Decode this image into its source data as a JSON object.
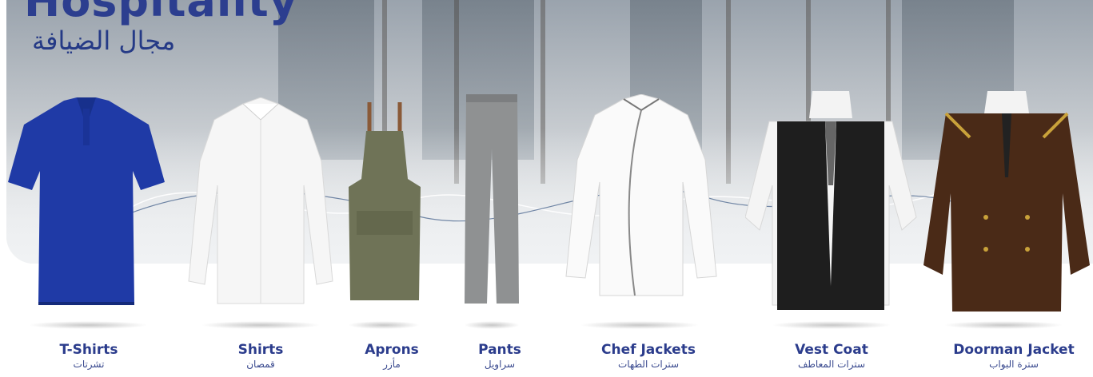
{
  "header": {
    "title_en": "Hospitality",
    "title_ar": "مجال الضيافة"
  },
  "products": [
    {
      "name_en": "T-Shirts",
      "name_ar": "تشرتات",
      "icon": "polo-tshirt-icon"
    },
    {
      "name_en": "Shirts",
      "name_ar": "قمصان",
      "icon": "dress-shirt-icon"
    },
    {
      "name_en": "Aprons",
      "name_ar": "مأزر",
      "icon": "apron-icon"
    },
    {
      "name_en": "Pants",
      "name_ar": "سراويل",
      "icon": "trousers-icon"
    },
    {
      "name_en": "Chef Jackets",
      "name_ar": "سترات الطهات",
      "icon": "chef-jacket-icon"
    },
    {
      "name_en": "Vest Coat",
      "name_ar": "سترات المعاطف",
      "icon": "vest-coat-icon"
    },
    {
      "name_en": "Doorman Jacket",
      "name_ar": "سترة البواب",
      "icon": "doorman-jacket-icon"
    }
  ],
  "colors": {
    "brand_blue": "#2b3c8c",
    "tshirt": "#1f3aa6",
    "shirt": "#f6f6f6",
    "apron": "#6f7357",
    "pants": "#8f9192",
    "chef": "#fafafa",
    "vest": "#1e1e1e",
    "doorman": "#4a2a17",
    "gold": "#c9a23a"
  }
}
